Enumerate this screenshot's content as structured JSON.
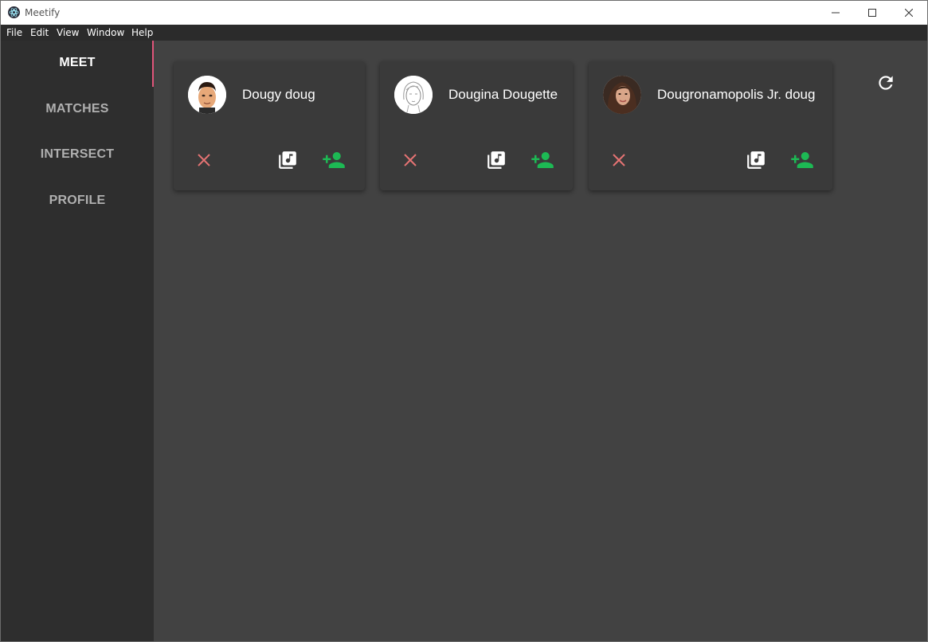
{
  "window": {
    "title": "Meetify",
    "controls": [
      "minimize-icon",
      "maximize-icon",
      "close-icon"
    ]
  },
  "menu": {
    "items": [
      "File",
      "Edit",
      "View",
      "Window",
      "Help"
    ]
  },
  "sidebar": {
    "items": [
      {
        "label": "MEET",
        "active": true
      },
      {
        "label": "MATCHES",
        "active": false
      },
      {
        "label": "INTERSECT",
        "active": false
      },
      {
        "label": "PROFILE",
        "active": false
      }
    ],
    "accent_color": "#e0557a"
  },
  "main": {
    "refresh_icon": "refresh-icon",
    "cards": [
      {
        "name": "Dougy doug",
        "avatar": "cartoon-man-avatar",
        "actions": [
          "reject-icon",
          "music-library-icon",
          "add-person-icon"
        ]
      },
      {
        "name": "Dougina Dougette",
        "avatar": "sketch-woman-avatar",
        "actions": [
          "reject-icon",
          "music-library-icon",
          "add-person-icon"
        ]
      },
      {
        "name": "Dougronamopolis Jr. doug",
        "avatar": "photo-woman-avatar",
        "actions": [
          "reject-icon",
          "music-library-icon",
          "add-person-icon"
        ]
      }
    ]
  },
  "colors": {
    "reject": "#e57373",
    "add": "#1db954",
    "card_bg": "#3a3a3a",
    "main_bg": "#424242",
    "sidebar_bg": "#2e2e2e"
  }
}
